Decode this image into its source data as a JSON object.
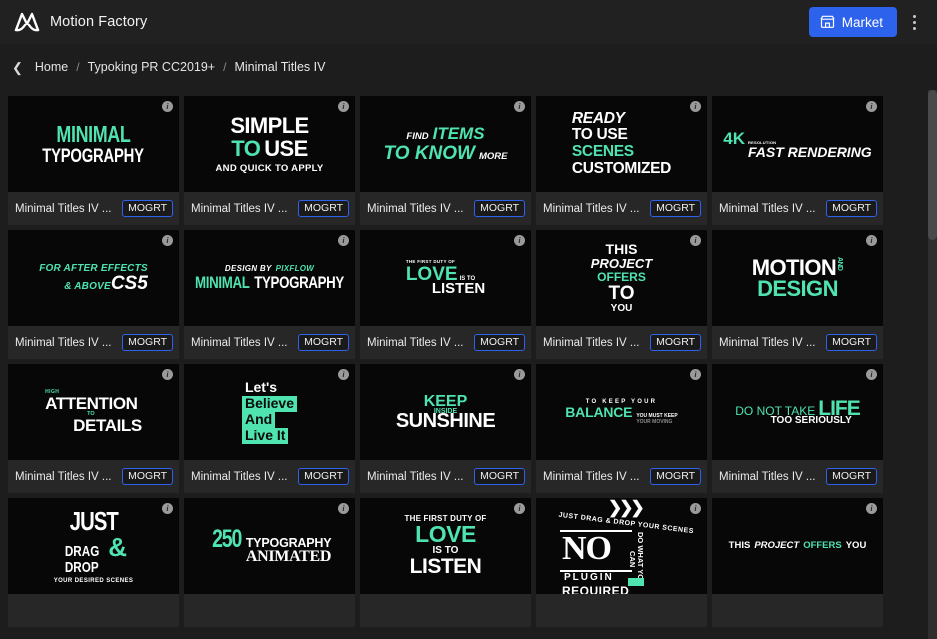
{
  "app": {
    "brand_name": "Motion Factory",
    "logo_icon": "motion-factory-logo",
    "market_label": "Market",
    "market_icon": "store-icon",
    "kebab_icon": "more-vertical-icon",
    "accent_blue": "#2d62ec",
    "accent_green": "#4fe3af",
    "background": "#1d1d1d",
    "topbar_background": "#212121",
    "card_background": "#272727",
    "thumb_background": "#070707"
  },
  "breadcrumb": {
    "back_icon": "chevron-left-icon",
    "separator": "/",
    "items": [
      {
        "label": "Home",
        "current": false
      },
      {
        "label": "Typoking PR CC2019+",
        "current": false
      },
      {
        "label": "Minimal Titles IV",
        "current": true
      }
    ]
  },
  "grid": {
    "columns": 5,
    "badge_label": "MOGRT",
    "info_icon": "info-icon",
    "info_glyph": "i",
    "items": [
      {
        "title": "Minimal Titles IV ...",
        "badge": "MOGRT",
        "art": "minimal-typography"
      },
      {
        "title": "Minimal Titles IV ...",
        "badge": "MOGRT",
        "art": "simple-to-use"
      },
      {
        "title": "Minimal Titles IV ...",
        "badge": "MOGRT",
        "art": "find-items-to-know-more"
      },
      {
        "title": "Minimal Titles IV ...",
        "badge": "MOGRT",
        "art": "ready-to-use-scenes-customized"
      },
      {
        "title": "Minimal Titles IV ...",
        "badge": "MOGRT",
        "art": "4k-fast-rendering"
      },
      {
        "title": "Minimal Titles IV ...",
        "badge": "MOGRT",
        "art": "for-after-effects-cs5"
      },
      {
        "title": "Minimal Titles IV ...",
        "badge": "MOGRT",
        "art": "design-by-pixflow"
      },
      {
        "title": "Minimal Titles IV ...",
        "badge": "MOGRT",
        "art": "love-is-to-listen-small"
      },
      {
        "title": "Minimal Titles IV ...",
        "badge": "MOGRT",
        "art": "this-project-offers-to-you"
      },
      {
        "title": "Minimal Titles IV ...",
        "badge": "MOGRT",
        "art": "motion-and-design"
      },
      {
        "title": "Minimal Titles IV ...",
        "badge": "MOGRT",
        "art": "high-attention-to-details"
      },
      {
        "title": "Minimal Titles IV ...",
        "badge": "MOGRT",
        "art": "lets-believe-and-live-it"
      },
      {
        "title": "Minimal Titles IV ...",
        "badge": "MOGRT",
        "art": "keep-sunshine"
      },
      {
        "title": "Minimal Titles IV ...",
        "badge": "MOGRT",
        "art": "to-keep-your-balance"
      },
      {
        "title": "Minimal Titles IV ...",
        "badge": "MOGRT",
        "art": "do-not-take-life-too-seriously"
      },
      {
        "title": "",
        "badge": "",
        "art": "just-drag-and-drop"
      },
      {
        "title": "",
        "badge": "",
        "art": "250-typography-animated"
      },
      {
        "title": "",
        "badge": "",
        "art": "the-first-duty-of-love-is-to-listen"
      },
      {
        "title": "",
        "badge": "",
        "art": "no-plugin-required"
      },
      {
        "title": "",
        "badge": "",
        "art": "this-project-offers-you"
      }
    ]
  },
  "artwork": {
    "minimal_typography": {
      "line1": "MINIMAL",
      "line2": "TYPOGRAPHY"
    },
    "simple_to_use": {
      "line1": "SIMPLE",
      "line2a": "TO",
      "line2b": "USE",
      "line3": "AND QUICK TO APPLY"
    },
    "find_items": {
      "find": "FIND",
      "items": "ITEMS",
      "to_know": "TO KNOW",
      "more": "MORE"
    },
    "ready_scenes": {
      "line1": "READY",
      "line2": "TO USE",
      "line3": "SCENES",
      "line4": "CUSTOMIZED"
    },
    "rendering_4k": {
      "fourk": "4K",
      "tiny": "RESOLUTION",
      "fast": "FAST RENDERING"
    },
    "after_effects": {
      "line1": "FOR AFTER EFFECTS",
      "line2": "& ABOVE",
      "cs5": "CS5"
    },
    "design_pixflow": {
      "design_by": "DESIGN BY",
      "pixflow": "PIXFLOW",
      "minimal": "MINIMAL",
      "typography": "TYPOGRAPHY"
    },
    "love_listen_small": {
      "duty": "THE FIRST DUTY OF",
      "love": "LOVE",
      "isto": "IS TO",
      "listen": "LISTEN"
    },
    "this_project": {
      "this": "THIS",
      "project": "PROJECT",
      "offers": "OFFERS",
      "to": "TO",
      "you": "YOU"
    },
    "motion_design": {
      "motion": "MOTION",
      "and": "AND",
      "design": "DESIGN"
    },
    "attention_details": {
      "high": "HIGH",
      "attention": "ATTENTION",
      "to": "TO",
      "details": "DETAILS"
    },
    "lets_believe": {
      "lets": "Let's",
      "believe": "Believe",
      "and": "And",
      "live_it": "Live It"
    },
    "keep_sunshine": {
      "keep": "KEEP",
      "inside": "INSIDE",
      "sunshine": "SUNSHINE"
    },
    "balance": {
      "top": "TO KEEP YOUR",
      "balance": "BALANCE",
      "small1": "YOU MUST KEEP",
      "small2": "YOUR MOVING"
    },
    "life_seriously": {
      "do_not": "DO NOT TAKE",
      "life": "LIFE",
      "too": "TOO SERIOUSLY"
    },
    "just_drag": {
      "just": "JUST",
      "drag": "DRAG",
      "drop": "DROP",
      "amp": "&",
      "desired": "YOUR DESIRED SCENES"
    },
    "typography_250": {
      "num": "250",
      "typography": "TYPOGRAPHY",
      "animated": "ANIMATED"
    },
    "first_duty_love": {
      "duty": "THE FIRST DUTY OF",
      "love": "LOVE",
      "isto": "IS TO",
      "listen": "LISTEN"
    },
    "no_plugin": {
      "chev": "❯❯❯",
      "drag": "JUST DRAG & DROP YOUR SCENES",
      "no": "NO",
      "vert": "DO WHAT YOU CAN",
      "plugin": "PLUGIN",
      "required": "REQUIRED"
    },
    "project_offers_you": {
      "this": "THIS",
      "project": "PROJECT",
      "offers": "OFFERS",
      "you": "YOU"
    }
  },
  "scrollbar": {
    "name": "vertical-scrollbar",
    "position_percent": 0
  }
}
